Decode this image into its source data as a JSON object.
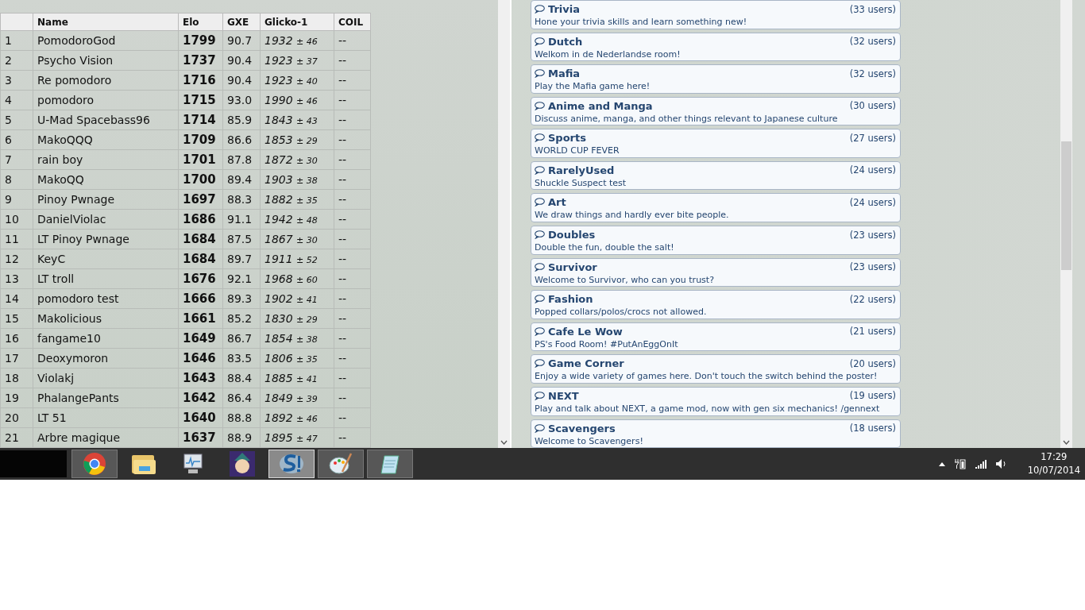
{
  "ladder": {
    "columns": [
      "",
      "Name",
      "Elo",
      "GXE",
      "Glicko-1",
      "COIL"
    ],
    "rows": [
      {
        "rank": "1",
        "name": "PomodoroGod",
        "elo": "1799",
        "gxe": "90.7",
        "glicko": "1932",
        "deviation": "± 46",
        "coil": "--"
      },
      {
        "rank": "2",
        "name": "Psycho Vision",
        "elo": "1737",
        "gxe": "90.4",
        "glicko": "1923",
        "deviation": "± 37",
        "coil": "--"
      },
      {
        "rank": "3",
        "name": "Re pomodoro",
        "elo": "1716",
        "gxe": "90.4",
        "glicko": "1923",
        "deviation": "± 40",
        "coil": "--"
      },
      {
        "rank": "4",
        "name": "pomodoro",
        "elo": "1715",
        "gxe": "93.0",
        "glicko": "1990",
        "deviation": "± 46",
        "coil": "--"
      },
      {
        "rank": "5",
        "name": "U-Mad Spacebass96",
        "elo": "1714",
        "gxe": "85.9",
        "glicko": "1843",
        "deviation": "± 43",
        "coil": "--"
      },
      {
        "rank": "6",
        "name": "MakoQQQ",
        "elo": "1709",
        "gxe": "86.6",
        "glicko": "1853",
        "deviation": "± 29",
        "coil": "--"
      },
      {
        "rank": "7",
        "name": "rain boy",
        "elo": "1701",
        "gxe": "87.8",
        "glicko": "1872",
        "deviation": "± 30",
        "coil": "--"
      },
      {
        "rank": "8",
        "name": "MakoQQ",
        "elo": "1700",
        "gxe": "89.4",
        "glicko": "1903",
        "deviation": "± 38",
        "coil": "--"
      },
      {
        "rank": "9",
        "name": "Pinoy Pwnage",
        "elo": "1697",
        "gxe": "88.3",
        "glicko": "1882",
        "deviation": "± 35",
        "coil": "--"
      },
      {
        "rank": "10",
        "name": "DanielViolac",
        "elo": "1686",
        "gxe": "91.1",
        "glicko": "1942",
        "deviation": "± 48",
        "coil": "--"
      },
      {
        "rank": "11",
        "name": "LT Pinoy Pwnage",
        "elo": "1684",
        "gxe": "87.5",
        "glicko": "1867",
        "deviation": "± 30",
        "coil": "--"
      },
      {
        "rank": "12",
        "name": "KeyC",
        "elo": "1684",
        "gxe": "89.7",
        "glicko": "1911",
        "deviation": "± 52",
        "coil": "--"
      },
      {
        "rank": "13",
        "name": "LT troll",
        "elo": "1676",
        "gxe": "92.1",
        "glicko": "1968",
        "deviation": "± 60",
        "coil": "--"
      },
      {
        "rank": "14",
        "name": "pomodoro test",
        "elo": "1666",
        "gxe": "89.3",
        "glicko": "1902",
        "deviation": "± 41",
        "coil": "--"
      },
      {
        "rank": "15",
        "name": "Makolicious",
        "elo": "1661",
        "gxe": "85.2",
        "glicko": "1830",
        "deviation": "± 29",
        "coil": "--"
      },
      {
        "rank": "16",
        "name": "fangame10",
        "elo": "1649",
        "gxe": "86.7",
        "glicko": "1854",
        "deviation": "± 38",
        "coil": "--"
      },
      {
        "rank": "17",
        "name": "Deoxymoron",
        "elo": "1646",
        "gxe": "83.5",
        "glicko": "1806",
        "deviation": "± 35",
        "coil": "--"
      },
      {
        "rank": "18",
        "name": "Violakj",
        "elo": "1643",
        "gxe": "88.4",
        "glicko": "1885",
        "deviation": "± 41",
        "coil": "--"
      },
      {
        "rank": "19",
        "name": "PhalangePants",
        "elo": "1642",
        "gxe": "86.4",
        "glicko": "1849",
        "deviation": "± 39",
        "coil": "--"
      },
      {
        "rank": "20",
        "name": "LT 51",
        "elo": "1640",
        "gxe": "88.8",
        "glicko": "1892",
        "deviation": "± 46",
        "coil": "--"
      },
      {
        "rank": "21",
        "name": "Arbre magique",
        "elo": "1637",
        "gxe": "88.9",
        "glicko": "1895",
        "deviation": "± 47",
        "coil": "--"
      }
    ]
  },
  "rooms": [
    {
      "title": "Trivia",
      "users": "(33 users)",
      "description": "Hone your trivia skills and learn something new!"
    },
    {
      "title": "Dutch",
      "users": "(32 users)",
      "description": "Welkom in de Nederlandse room!"
    },
    {
      "title": "Mafia",
      "users": "(32 users)",
      "description": "Play the Mafia game here!"
    },
    {
      "title": "Anime and Manga",
      "users": "(30 users)",
      "description": "Discuss anime, manga, and other things relevant to Japanese culture"
    },
    {
      "title": "Sports",
      "users": "(27 users)",
      "description": "WORLD CUP FEVER"
    },
    {
      "title": "RarelyUsed",
      "users": "(24 users)",
      "description": "Shuckle Suspect test"
    },
    {
      "title": "Art",
      "users": "(24 users)",
      "description": "We draw things and hardly ever bite people."
    },
    {
      "title": "Doubles",
      "users": "(23 users)",
      "description": "Double the fun, double the salt!"
    },
    {
      "title": "Survivor",
      "users": "(23 users)",
      "description": "Welcome to Survivor, who can you trust?"
    },
    {
      "title": "Fashion",
      "users": "(22 users)",
      "description": "Popped collars/polos/crocs not allowed."
    },
    {
      "title": "Cafe Le Wow",
      "users": "(21 users)",
      "description": "PS's Food Room! #PutAnEggOnIt"
    },
    {
      "title": "Game Corner",
      "users": "(20 users)",
      "description": "Enjoy a wide variety of games here. Don't touch the switch behind the poster!"
    },
    {
      "title": "NEXT",
      "users": "(19 users)",
      "description": "Play and talk about NEXT, a game mod, now with gen six mechanics! /gennext"
    },
    {
      "title": "Scavengers",
      "users": "(18 users)",
      "description": "Welcome to Scavengers!"
    }
  ],
  "taskbar": {
    "apps": [
      {
        "kind": "thumbnail"
      },
      {
        "kind": "browser",
        "open": true,
        "selected": false
      },
      {
        "kind": "folder",
        "open": false,
        "selected": false
      },
      {
        "kind": "monitor",
        "open": false,
        "selected": false
      },
      {
        "kind": "game",
        "open": false,
        "selected": false
      },
      {
        "kind": "showdown",
        "open": true,
        "selected": true
      },
      {
        "kind": "paint",
        "open": true,
        "selected": false
      },
      {
        "kind": "notepad",
        "open": true,
        "selected": false
      }
    ],
    "time": "17:29",
    "date": "10/07/2014"
  }
}
